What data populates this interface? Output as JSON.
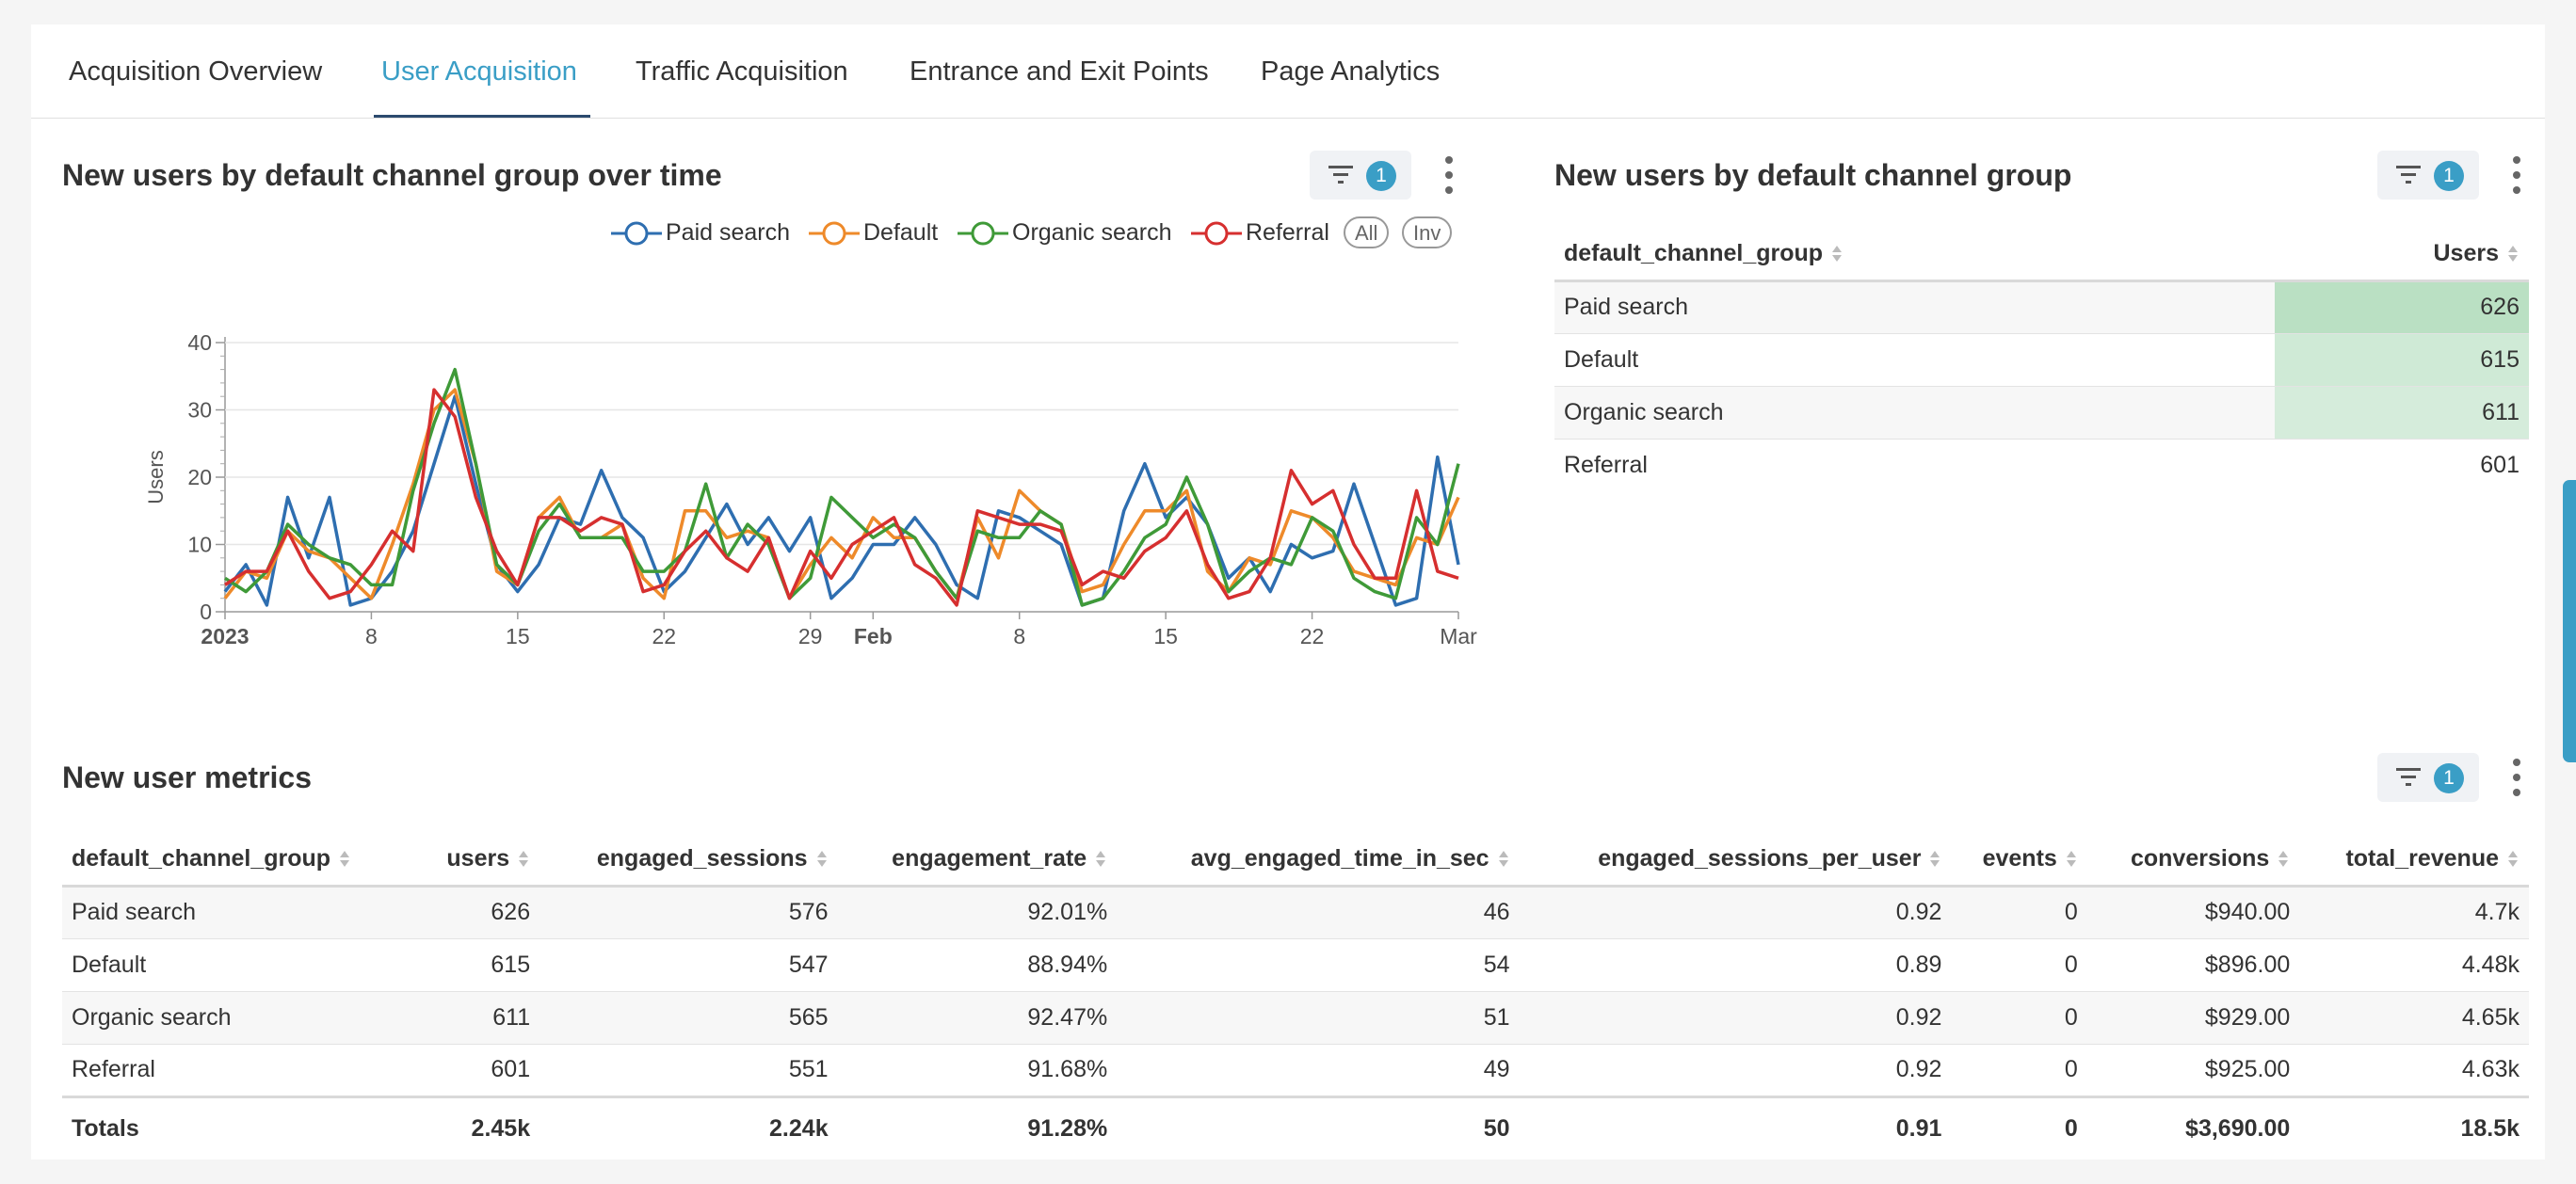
{
  "tabs": [
    {
      "label": "Acquisition Overview"
    },
    {
      "label": "User Acquisition"
    },
    {
      "label": "Traffic Acquisition"
    },
    {
      "label": "Entrance and Exit Points"
    },
    {
      "label": "Page Analytics"
    }
  ],
  "active_tab": "User Acquisition",
  "colors": {
    "accent": "#3a9ec6",
    "paid_search": "#2e6eb0",
    "default": "#ee8a2a",
    "organic_search": "#3f9a38",
    "referral": "#d62f2f"
  },
  "chart_panel": {
    "title": "New users by default channel group over time",
    "filter_count": "1",
    "legend_all": "All",
    "legend_inv": "Inv"
  },
  "chart_data": {
    "type": "line",
    "ylabel": "Users",
    "ylim": [
      0,
      40
    ],
    "yticks": [
      "0",
      "10",
      "20",
      "30",
      "40"
    ],
    "xticks": [
      "2023",
      "8",
      "15",
      "22",
      "29",
      "Feb",
      "8",
      "15",
      "22",
      "Mar"
    ],
    "x_start": "2023-01-01",
    "x_end": "2023-03-01",
    "series": [
      {
        "name": "Paid search",
        "color": "#2e6eb0",
        "values": [
          3,
          7,
          1,
          17,
          8,
          17,
          1,
          2,
          6,
          12,
          22,
          32,
          19,
          7,
          3,
          7,
          14,
          13,
          21,
          14,
          11,
          3,
          6,
          11,
          16,
          10,
          14,
          9,
          14,
          2,
          5,
          10,
          10,
          14,
          10,
          4,
          2,
          15,
          14,
          12,
          10,
          1,
          2,
          15,
          22,
          14,
          17,
          13,
          5,
          8,
          3,
          10,
          8,
          9,
          19,
          10,
          1,
          2,
          23,
          7
        ]
      },
      {
        "name": "Default",
        "color": "#ee8a2a",
        "values": [
          2,
          6,
          5,
          12,
          9,
          8,
          5,
          2,
          10,
          19,
          30,
          33,
          22,
          6,
          4,
          14,
          17,
          11,
          11,
          13,
          5,
          2,
          15,
          15,
          11,
          12,
          11,
          2,
          7,
          11,
          8,
          14,
          11,
          11,
          6,
          2,
          14,
          8,
          18,
          15,
          13,
          3,
          4,
          10,
          15,
          15,
          18,
          6,
          3,
          8,
          7,
          15,
          14,
          11,
          6,
          5,
          4,
          11,
          10,
          17
        ]
      },
      {
        "name": "Organic search",
        "color": "#3f9a38",
        "values": [
          5,
          3,
          6,
          13,
          10,
          8,
          7,
          4,
          4,
          18,
          28,
          36,
          22,
          7,
          4,
          12,
          16,
          11,
          11,
          11,
          6,
          6,
          9,
          19,
          8,
          13,
          10,
          2,
          5,
          17,
          14,
          11,
          13,
          11,
          6,
          2,
          12,
          11,
          11,
          15,
          13,
          1,
          2,
          6,
          11,
          13,
          20,
          13,
          3,
          6,
          8,
          7,
          14,
          12,
          5,
          3,
          2,
          14,
          10,
          22
        ]
      },
      {
        "name": "Referral",
        "color": "#d62f2f",
        "values": [
          4,
          6,
          6,
          12,
          6,
          2,
          3,
          7,
          12,
          9,
          33,
          29,
          17,
          9,
          4,
          14,
          14,
          12,
          14,
          13,
          3,
          4,
          9,
          12,
          8,
          6,
          11,
          2,
          9,
          5,
          10,
          12,
          14,
          7,
          5,
          1,
          15,
          14,
          13,
          13,
          12,
          4,
          6,
          5,
          9,
          11,
          15,
          7,
          2,
          3,
          8,
          21,
          16,
          18,
          10,
          5,
          5,
          18,
          6,
          5
        ]
      }
    ]
  },
  "table_panel": {
    "title": "New users by default channel group",
    "filter_count": "1",
    "headers": [
      "default_channel_group",
      "Users"
    ],
    "rows": [
      {
        "group": "Paid search",
        "users": "626",
        "users_num": 626
      },
      {
        "group": "Default",
        "users": "615",
        "users_num": 615
      },
      {
        "group": "Organic search",
        "users": "611",
        "users_num": 611
      },
      {
        "group": "Referral",
        "users": "601",
        "users_num": 601
      }
    ]
  },
  "metrics_panel": {
    "title": "New user metrics",
    "filter_count": "1",
    "headers": [
      "default_channel_group",
      "users",
      "engaged_sessions",
      "engagement_rate",
      "avg_engaged_time_in_sec",
      "engaged_sessions_per_user",
      "events",
      "conversions",
      "total_revenue"
    ],
    "rows": [
      [
        "Paid search",
        "626",
        "576",
        "92.01%",
        "46",
        "0.92",
        "0",
        "$940.00",
        "4.7k"
      ],
      [
        "Default",
        "615",
        "547",
        "88.94%",
        "54",
        "0.89",
        "0",
        "$896.00",
        "4.48k"
      ],
      [
        "Organic search",
        "611",
        "565",
        "92.47%",
        "51",
        "0.92",
        "0",
        "$929.00",
        "4.65k"
      ],
      [
        "Referral",
        "601",
        "551",
        "91.68%",
        "49",
        "0.92",
        "0",
        "$925.00",
        "4.63k"
      ]
    ],
    "totals": [
      "Totals",
      "2.45k",
      "2.24k",
      "91.28%",
      "50",
      "0.91",
      "0",
      "$3,690.00",
      "18.5k"
    ]
  }
}
